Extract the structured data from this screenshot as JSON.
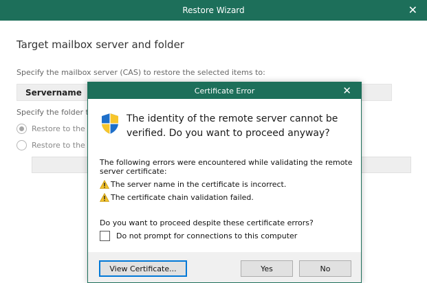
{
  "wizard": {
    "title": "Restore Wizard",
    "close_glyph": "✕",
    "section_title": "Target mailbox server and folder",
    "cas_label": "Specify the mailbox server (CAS) to restore the selected items to:",
    "server_value": "Servername",
    "folder_label": "Specify the folder to",
    "radio_options": [
      {
        "label": "Restore to the o",
        "selected": true
      },
      {
        "label": "Restore to the f",
        "selected": false
      }
    ]
  },
  "dialog": {
    "title": "Certificate Error",
    "close_glyph": "✕",
    "icon": "uac-shield-icon",
    "main_message": "The identity of the remote server cannot be verified. Do you want to proceed anyway?",
    "errors_intro": "The following errors were encountered while validating the remote server certificate:",
    "errors": [
      {
        "icon": "warning-icon",
        "text": "The server name in the certificate is incorrect."
      },
      {
        "icon": "warning-icon",
        "text": "The certificate chain validation failed."
      }
    ],
    "question": "Do you want to proceed despite these certificate errors?",
    "checkbox": {
      "label": "Do not prompt for connections to this computer",
      "checked": false
    },
    "buttons": {
      "view_certificate": "View Certificate...",
      "yes": "Yes",
      "no": "No"
    }
  },
  "colors": {
    "titlebar": "#1d6f5a",
    "field_bg": "#eeeeee",
    "focus_border": "#0078d7"
  }
}
